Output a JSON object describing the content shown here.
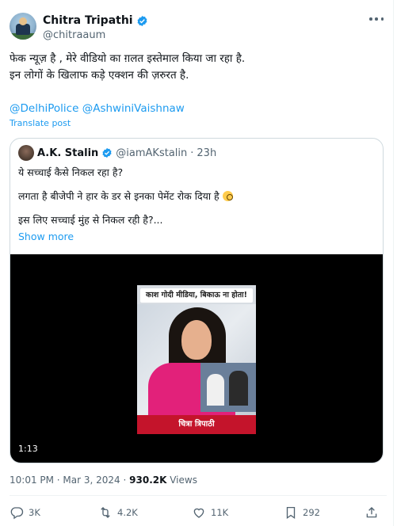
{
  "author": {
    "name": "Chitra Tripathi",
    "handle": "@chitraaum"
  },
  "tweet": {
    "line1": "फेक न्यूज़ है , मेरे वीडियो का ग़लत इस्तेमाल किया जा रहा है.",
    "line2": "इन लोगों के खिलाफ कड़े एक्शन की ज़रुरत है.",
    "mention1": "@DelhiPolice",
    "mention2": "@AshwiniVaishnaw",
    "translate": "Translate post"
  },
  "quote": {
    "name": "A.K. Stalin",
    "handle": "@iamAKstalin",
    "separator": "·",
    "time": "23h",
    "line1": "ये सच्चाई कैसे निकल रहा है?",
    "line2": "लगता है बीजेपी ने हार के डर से इनका पेमेंट रोक दिया है",
    "line3": "इस लिए सच्चाई मुंह से निकल रही है?...",
    "show_more": "Show more",
    "video": {
      "caption_top": "काश गोदी मीडिया, बिकाऊ ना होता!",
      "caption_bottom": "चित्रा त्रिपाठी",
      "duration": "1:13"
    }
  },
  "meta": {
    "timestamp": "10:01 PM · Mar 3, 2024 · ",
    "views_count": "930.2K",
    "views_label": " Views"
  },
  "actions": {
    "replies": "3K",
    "reposts": "4.2K",
    "likes": "11K",
    "views": "292"
  },
  "colors": {
    "accent": "#1d9bf0",
    "secondary_text": "#536471",
    "border": "#cfd9de"
  }
}
